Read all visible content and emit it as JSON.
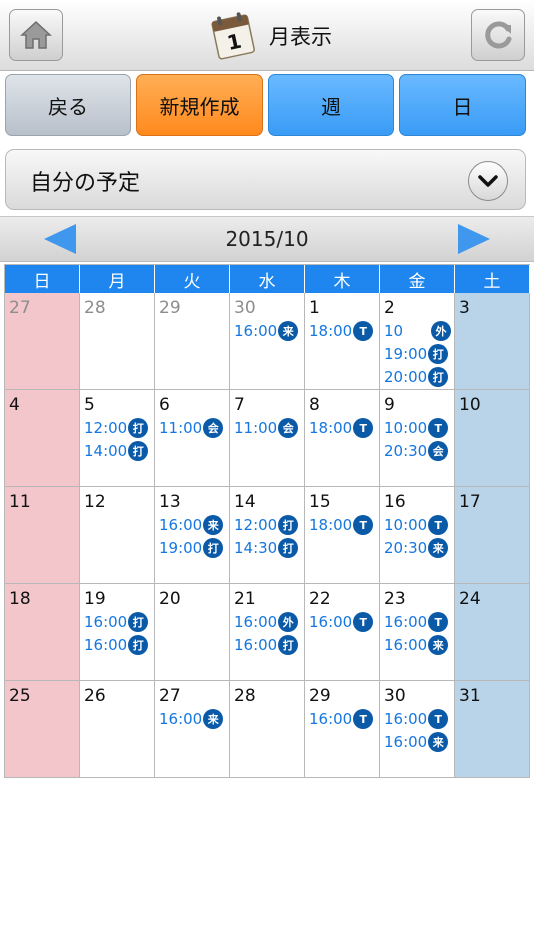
{
  "header": {
    "title": "月表示",
    "calendar_icon_number": "1"
  },
  "nav": {
    "back": "戻る",
    "new": "新規作成",
    "week": "週",
    "day": "日"
  },
  "selector": {
    "label": "自分の予定"
  },
  "month": {
    "label": "2015/10"
  },
  "colors": {
    "header_blue": "#1e86ee",
    "sunday": "#f2c6cb",
    "saturday": "#b9d4e8",
    "event_text": "#1577e0",
    "badge": "#0b5aa8",
    "new_button": "#ff8a1e"
  },
  "weekdays": [
    "日",
    "月",
    "火",
    "水",
    "木",
    "金",
    "土"
  ],
  "weeks": [
    [
      {
        "day": "27",
        "other": true,
        "events": []
      },
      {
        "day": "28",
        "other": true,
        "events": []
      },
      {
        "day": "29",
        "other": true,
        "events": []
      },
      {
        "day": "30",
        "other": true,
        "events": [
          {
            "time": "16:00",
            "tag": "来"
          }
        ]
      },
      {
        "day": "1",
        "events": [
          {
            "time": "18:00",
            "tag": "T"
          }
        ]
      },
      {
        "day": "2",
        "events": [
          {
            "time": "10",
            "tag": "外"
          },
          {
            "time": "19:00",
            "tag": "打"
          },
          {
            "time": "20:00",
            "tag": "打"
          }
        ]
      },
      {
        "day": "3",
        "events": []
      }
    ],
    [
      {
        "day": "4",
        "events": []
      },
      {
        "day": "5",
        "events": [
          {
            "time": "12:00",
            "tag": "打"
          },
          {
            "time": "14:00",
            "tag": "打"
          }
        ]
      },
      {
        "day": "6",
        "events": [
          {
            "time": "11:00",
            "tag": "会"
          }
        ]
      },
      {
        "day": "7",
        "events": [
          {
            "time": "11:00",
            "tag": "会"
          }
        ]
      },
      {
        "day": "8",
        "events": [
          {
            "time": "18:00",
            "tag": "T"
          }
        ]
      },
      {
        "day": "9",
        "events": [
          {
            "time": "10:00",
            "tag": "T"
          },
          {
            "time": "20:30",
            "tag": "会"
          }
        ]
      },
      {
        "day": "10",
        "events": []
      }
    ],
    [
      {
        "day": "11",
        "events": []
      },
      {
        "day": "12",
        "events": []
      },
      {
        "day": "13",
        "events": [
          {
            "time": "16:00",
            "tag": "来"
          },
          {
            "time": "19:00",
            "tag": "打"
          }
        ]
      },
      {
        "day": "14",
        "events": [
          {
            "time": "12:00",
            "tag": "打"
          },
          {
            "time": "14:30",
            "tag": "打"
          }
        ]
      },
      {
        "day": "15",
        "events": [
          {
            "time": "18:00",
            "tag": "T"
          }
        ]
      },
      {
        "day": "16",
        "events": [
          {
            "time": "10:00",
            "tag": "T"
          },
          {
            "time": "20:30",
            "tag": "来"
          }
        ]
      },
      {
        "day": "17",
        "events": []
      }
    ],
    [
      {
        "day": "18",
        "events": []
      },
      {
        "day": "19",
        "events": [
          {
            "time": "16:00",
            "tag": "打"
          },
          {
            "time": "16:00",
            "tag": "打"
          }
        ]
      },
      {
        "day": "20",
        "events": []
      },
      {
        "day": "21",
        "events": [
          {
            "time": "16:00",
            "tag": "外"
          },
          {
            "time": "16:00",
            "tag": "打"
          }
        ]
      },
      {
        "day": "22",
        "events": [
          {
            "time": "16:00",
            "tag": "T"
          }
        ]
      },
      {
        "day": "23",
        "events": [
          {
            "time": "16:00",
            "tag": "T"
          },
          {
            "time": "16:00",
            "tag": "来"
          }
        ]
      },
      {
        "day": "24",
        "events": []
      }
    ],
    [
      {
        "day": "25",
        "events": []
      },
      {
        "day": "26",
        "events": []
      },
      {
        "day": "27",
        "events": [
          {
            "time": "16:00",
            "tag": "来"
          }
        ]
      },
      {
        "day": "28",
        "events": []
      },
      {
        "day": "29",
        "events": [
          {
            "time": "16:00",
            "tag": "T"
          }
        ]
      },
      {
        "day": "30",
        "events": [
          {
            "time": "16:00",
            "tag": "T"
          },
          {
            "time": "16:00",
            "tag": "来"
          }
        ]
      },
      {
        "day": "31",
        "events": []
      }
    ]
  ]
}
